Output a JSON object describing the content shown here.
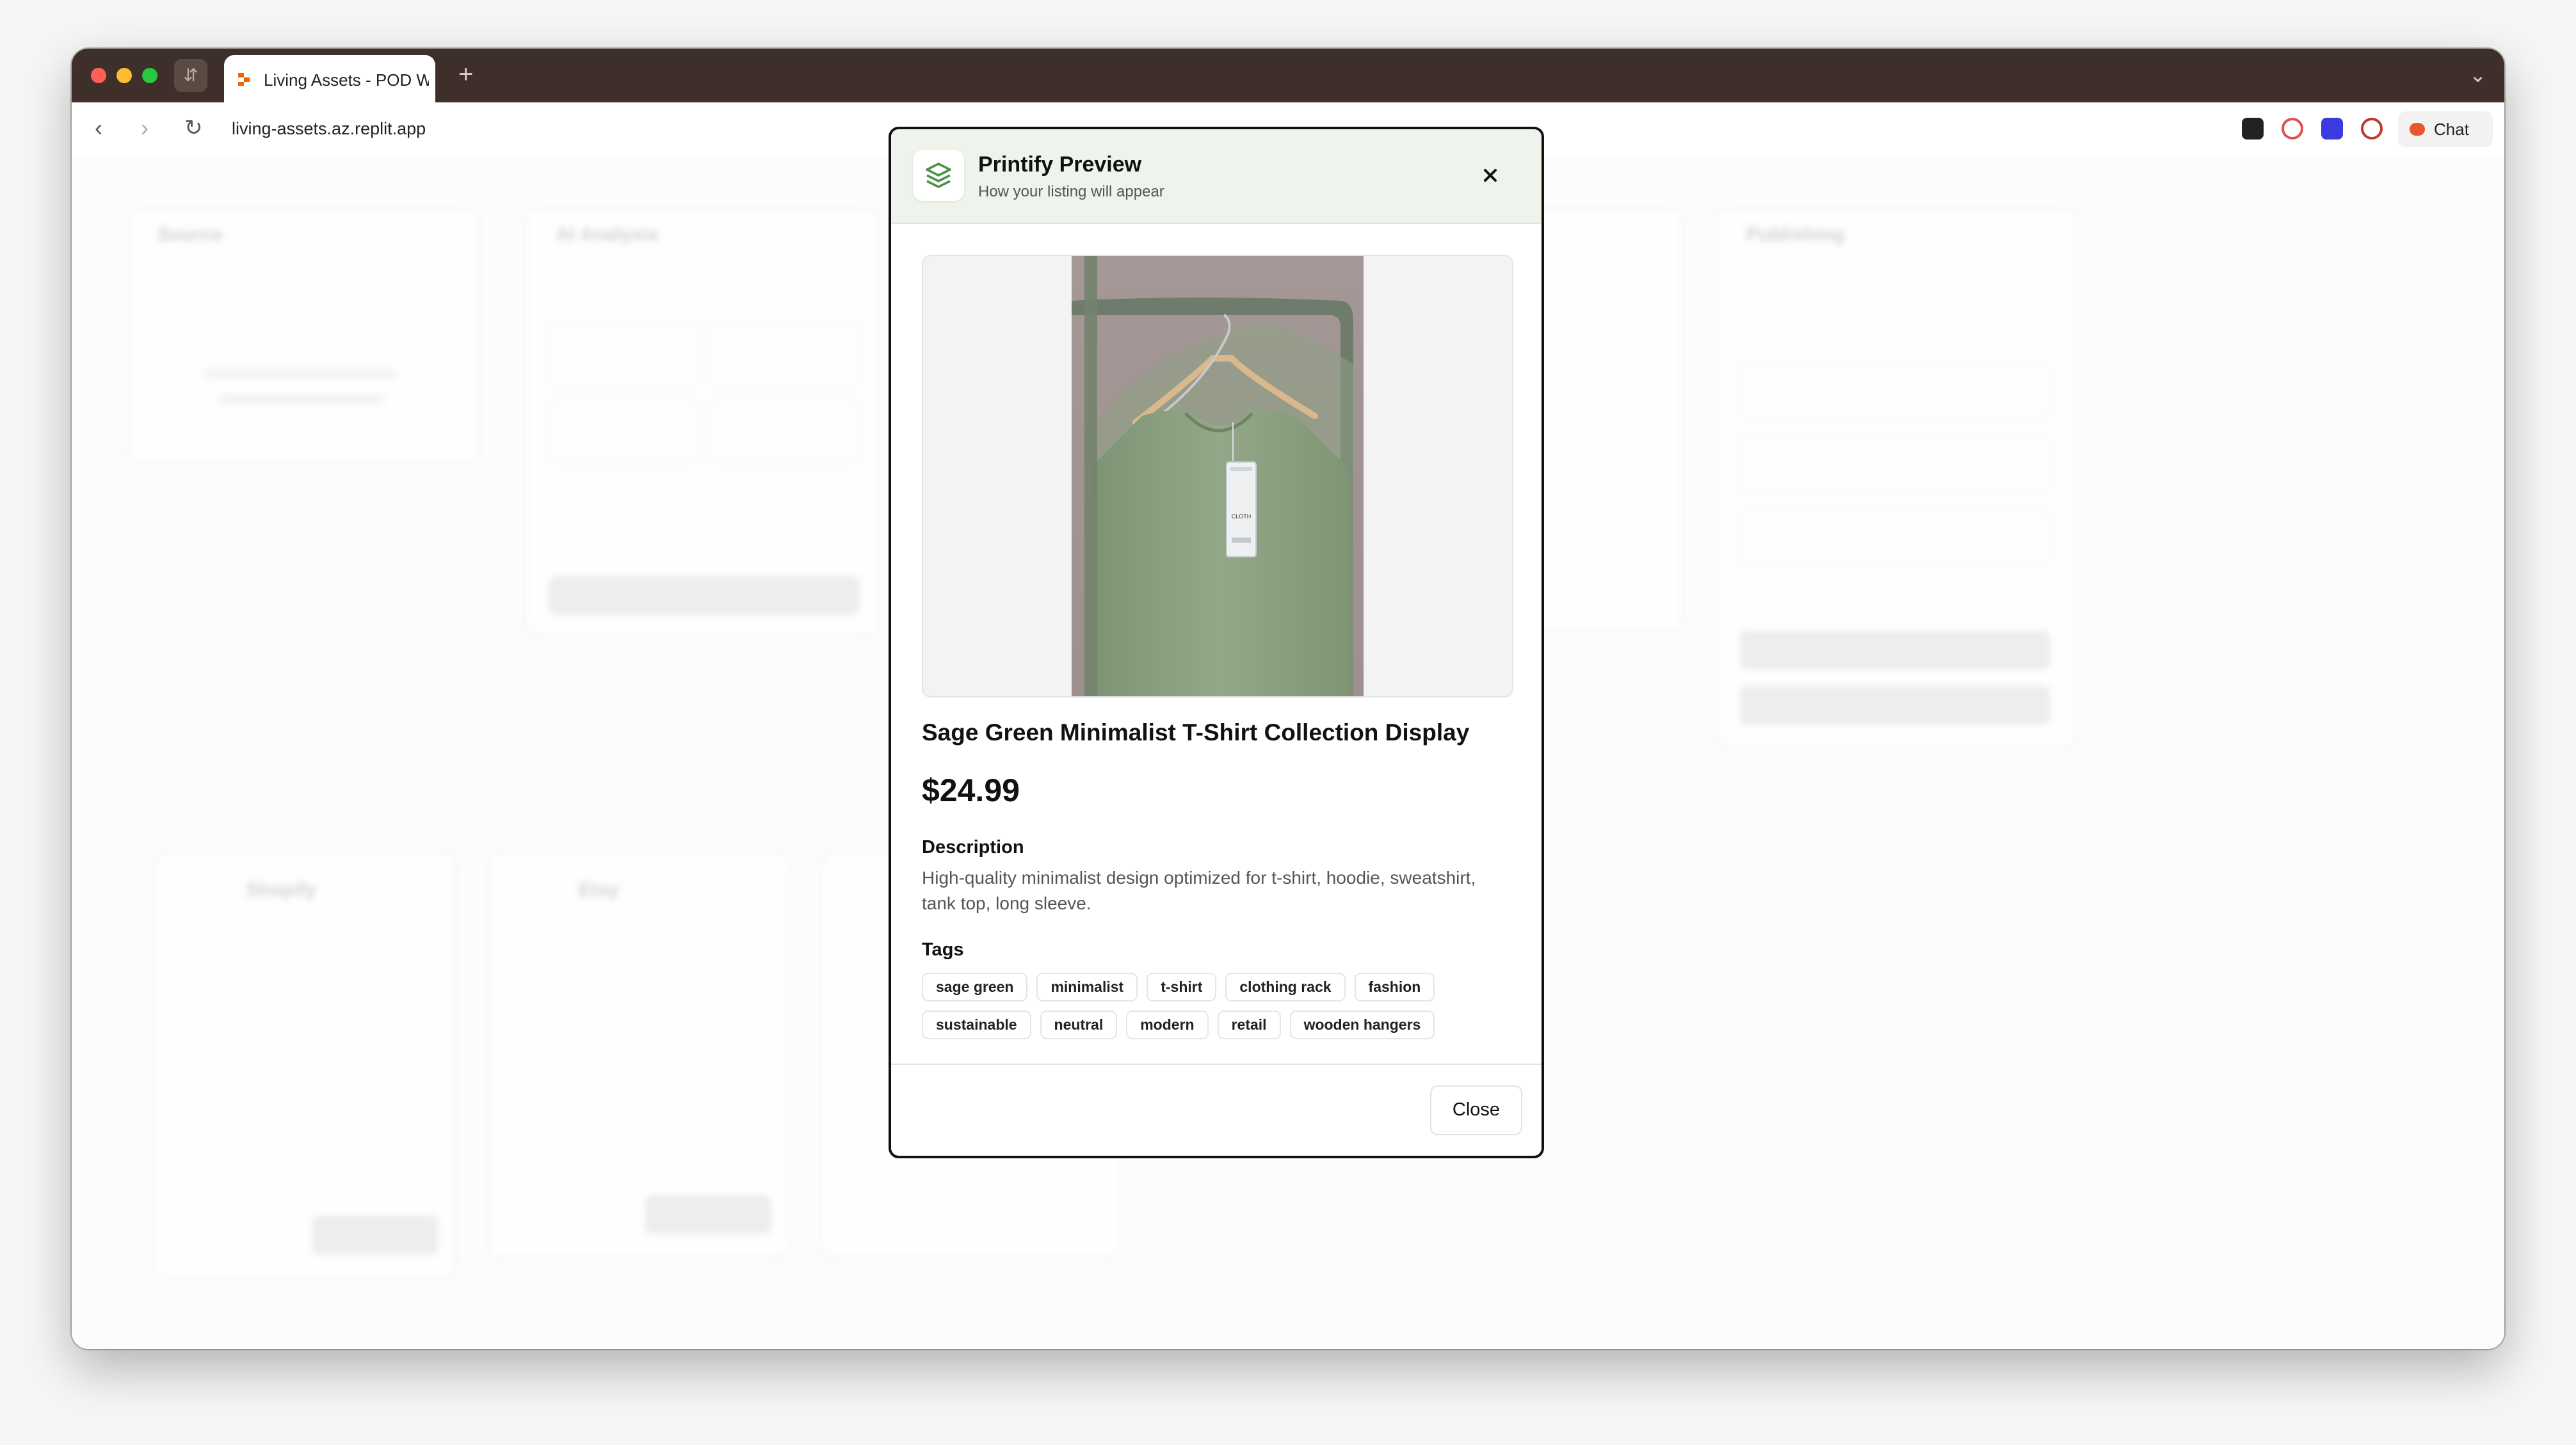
{
  "browser": {
    "tab_title": "Living Assets - POD W",
    "new_tab": "+",
    "url": "living-assets.az.replit.app",
    "chat_label": "Chat"
  },
  "background_cards": {
    "source": "Source",
    "ai_analysis": "AI Analysis",
    "publishing": "Publishing",
    "shopify": "Shopify",
    "etsy": "Etsy"
  },
  "modal": {
    "title": "Printify Preview",
    "subtitle": "How your listing will appear",
    "product_title": "Sage Green Minimalist T-Shirt Collection Display",
    "price": "$24.99",
    "description_label": "Description",
    "description": "High-quality minimalist design optimized for t-shirt, hoodie, sweatshirt, tank top, long sleeve.",
    "tags_label": "Tags",
    "tags": [
      "sage green",
      "minimalist",
      "t-shirt",
      "clothing rack",
      "fashion",
      "sustainable",
      "neutral",
      "modern",
      "retail",
      "wooden hangers"
    ],
    "close_label": "Close",
    "product_tag_text": "CLOTH"
  },
  "colors": {
    "titlebar": "#3f2f2a",
    "modal_header": "#eef4ec",
    "shirt": "#8a9f80",
    "accent": "#4f8f4a"
  }
}
